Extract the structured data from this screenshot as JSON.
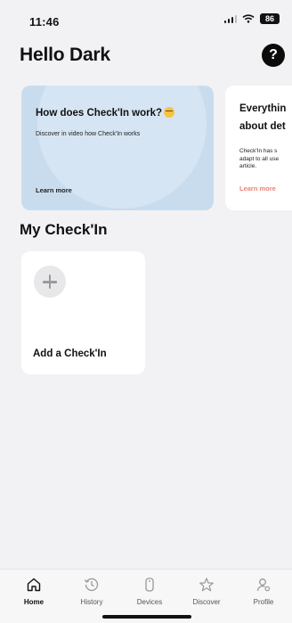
{
  "status_bar": {
    "time": "11:46",
    "battery": "86"
  },
  "header": {
    "title": "Hello Dark",
    "help_label": "?"
  },
  "cards": [
    {
      "title": "How does Check'In work?",
      "description": "Discover in video how Check'In works",
      "link": "Learn more",
      "emoji": "nerd-face-icon",
      "background": "#c9dcee"
    },
    {
      "title_line1": "Everythin",
      "title_line2": "about det",
      "description_line1": "Check'In has s",
      "description_line2": "adapt to all use",
      "description_line3": "article.",
      "link": "Learn more",
      "link_color": "#e8837a"
    }
  ],
  "section": {
    "title": "My Check'In",
    "add_label": "Add a Check'In"
  },
  "tabs": [
    {
      "label": "Home",
      "icon": "home-icon",
      "active": true
    },
    {
      "label": "History",
      "icon": "history-icon",
      "active": false
    },
    {
      "label": "Devices",
      "icon": "device-icon",
      "active": false
    },
    {
      "label": "Discover",
      "icon": "star-icon",
      "active": false
    },
    {
      "label": "Profile",
      "icon": "profile-icon",
      "active": false
    }
  ]
}
